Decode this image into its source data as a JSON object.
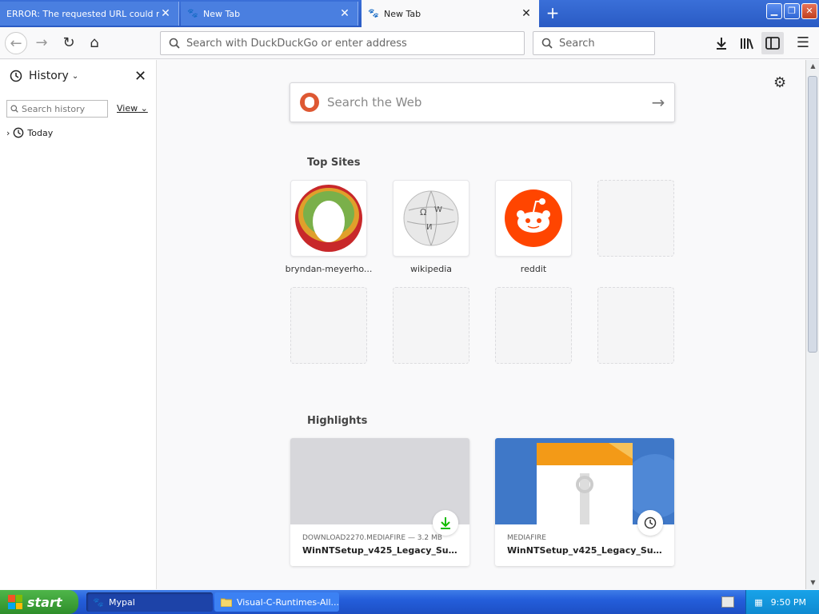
{
  "tabs": [
    {
      "title": "ERROR: The requested URL could not be retrieved"
    },
    {
      "title": "New Tab"
    },
    {
      "title": "New Tab"
    }
  ],
  "toolbar": {
    "url_placeholder": "Search with DuckDuckGo or enter address",
    "search_placeholder": "Search"
  },
  "sidebar": {
    "title": "History",
    "search_placeholder": "Search history",
    "view_label": "View",
    "items": [
      {
        "label": "Today"
      }
    ]
  },
  "newtab": {
    "websearch_placeholder": "Search the Web",
    "top_sites_title": "Top Sites",
    "top_sites": [
      {
        "label": "bryndan-meyerho..."
      },
      {
        "label": "wikipedia"
      },
      {
        "label": "reddit"
      }
    ],
    "highlights_title": "Highlights",
    "highlights": [
      {
        "host": "DOWNLOAD2270.MEDIAFIRE — 3.2 MB",
        "title": "WinNTSetup_v425_Legacy_Supp..."
      },
      {
        "host": "MEDIAFIRE",
        "title": "WinNTSetup_v425_Legacy_Supp..."
      }
    ]
  },
  "taskbar": {
    "start_label": "start",
    "tasks": [
      {
        "label": "Mypal"
      },
      {
        "label": "Visual-C-Runtimes-All..."
      }
    ],
    "clock": "9:50 PM"
  },
  "colors": {
    "xp_blue": "#245edb",
    "start_green": "#3c9a36",
    "ddg_orange": "#de5833",
    "reddit_orange": "#ff4500"
  }
}
